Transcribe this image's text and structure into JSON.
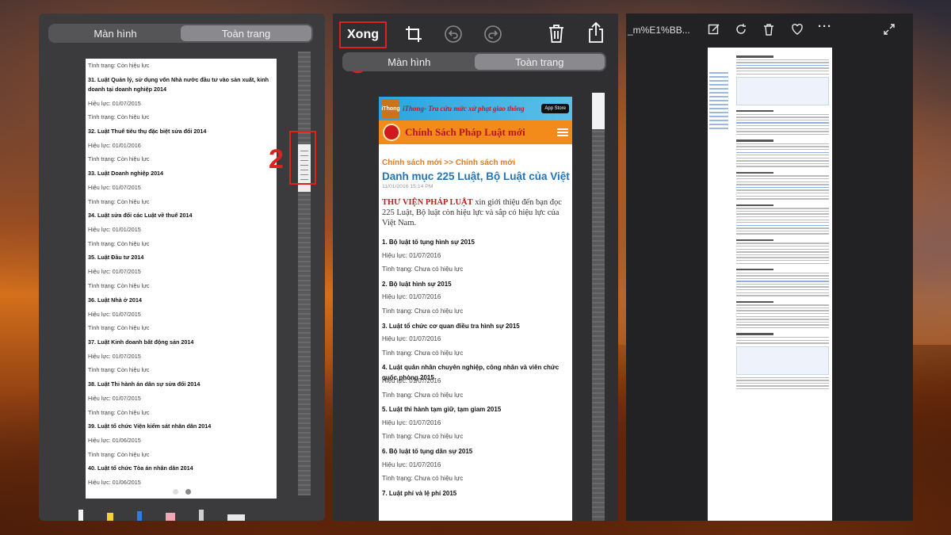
{
  "left_panel": {
    "segment": {
      "options": [
        "Màn hình",
        "Toàn trang"
      ],
      "selected": "Toàn trang"
    },
    "doc_rows": [
      {
        "text": "Tình trạng: Còn hiệu lực",
        "bold": false
      },
      {
        "text": "31. Luật Quản lý, sử dụng vốn Nhà nước đầu tư vào sản xuất, kinh doanh tại doanh nghiệp 2014",
        "bold": true
      },
      {
        "text": "Hiệu lực: 01/07/2015",
        "bold": false
      },
      {
        "text": "Tình trạng: Còn hiệu lực",
        "bold": false
      },
      {
        "text": "32. Luật Thuế tiêu thụ đặc biệt sửa đổi 2014",
        "bold": true
      },
      {
        "text": "Hiệu lực: 01/01/2016",
        "bold": false
      },
      {
        "text": "Tình trạng: Còn hiệu lực",
        "bold": false
      },
      {
        "text": "33. Luật Doanh nghiệp 2014",
        "bold": true
      },
      {
        "text": "Hiệu lực: 01/07/2015",
        "bold": false
      },
      {
        "text": "Tình trạng: Còn hiệu lực",
        "bold": false
      },
      {
        "text": "34. Luật sửa đổi các Luật về thuế 2014",
        "bold": true
      },
      {
        "text": "Hiệu lực: 01/01/2015",
        "bold": false
      },
      {
        "text": "Tình trạng: Còn hiệu lực",
        "bold": false
      },
      {
        "text": "35. Luật Đầu tư 2014",
        "bold": true
      },
      {
        "text": "Hiệu lực: 01/07/2015",
        "bold": false
      },
      {
        "text": "Tình trạng: Còn hiệu lực",
        "bold": false
      },
      {
        "text": "36. Luật Nhà ở 2014",
        "bold": true
      },
      {
        "text": "Hiệu lực: 01/07/2015",
        "bold": false
      },
      {
        "text": "Tình trạng: Còn hiệu lực",
        "bold": false
      },
      {
        "text": "37. Luật Kinh doanh bất động sản 2014",
        "bold": true
      },
      {
        "text": "Hiệu lực: 01/07/2015",
        "bold": false
      },
      {
        "text": "Tình trạng: Còn hiệu lực",
        "bold": false
      },
      {
        "text": "38. Luật Thi hành án dân sự sửa đổi 2014",
        "bold": true
      },
      {
        "text": "Hiệu lực: 01/07/2015",
        "bold": false
      },
      {
        "text": "Tình trạng: Còn hiệu lực",
        "bold": false
      },
      {
        "text": "39. Luật tổ chức Viện kiểm sát nhân dân 2014",
        "bold": true
      },
      {
        "text": "Hiệu lực: 01/06/2015",
        "bold": false
      },
      {
        "text": "Tình trạng: Còn hiệu lực",
        "bold": false
      },
      {
        "text": "40. Luật tổ chức Tòa án nhân dân 2014",
        "bold": true
      },
      {
        "text": "Hiệu lực: 01/06/2015",
        "bold": false
      }
    ],
    "step_label": "2"
  },
  "middle_panel": {
    "done_label": "Xong",
    "step_label": "3",
    "icons": [
      "crop-icon",
      "undo-icon",
      "redo-icon",
      "trash-icon",
      "share-icon"
    ],
    "segment": {
      "options": [
        "Màn hình",
        "Toàn trang"
      ],
      "selected": "Toàn trang"
    },
    "banner_top_text": "iThong- Tra cứu mức xử phạt giao thông",
    "banner_logo_text": "iThong",
    "app_store_label": "App Store",
    "banner_site_text": "Chính Sách Pháp Luật mới",
    "breadcrumb": "Chính sách mới >> Chính sách mới",
    "title": "Danh mục 225 Luật, Bộ Luật của Việt Nam",
    "date": "11/01/2016 15:14 PM",
    "intro_highlight": "THƯ VIỆN PHÁP LUẬT",
    "intro_rest": " xin giới thiệu đến bạn đọc 225 Luật, Bộ luật còn hiệu lực và sắp có hiệu lực của Việt Nam.",
    "doc_rows": [
      {
        "text": "1. Bộ luật tố tụng hình sự 2015",
        "bold": true
      },
      {
        "text": "Hiệu lực: 01/07/2016",
        "bold": false
      },
      {
        "text": "Tình trạng: Chưa có hiệu lực",
        "bold": false
      },
      {
        "text": "2. Bộ luật hình sự 2015",
        "bold": true
      },
      {
        "text": "Hiệu lực: 01/07/2016",
        "bold": false
      },
      {
        "text": "Tình trạng: Chưa có hiệu lực",
        "bold": false
      },
      {
        "text": "3. Luật tổ chức cơ quan điều tra hình sự 2015",
        "bold": true
      },
      {
        "text": "Hiệu lực: 01/07/2016",
        "bold": false
      },
      {
        "text": "Tình trạng: Chưa có hiệu lực",
        "bold": false
      },
      {
        "text": "4. Luật quân nhân chuyên nghiệp, công nhân và viên chức quốc phòng 2015",
        "bold": true
      },
      {
        "text": "Hiệu lực: 01/07/2016",
        "bold": false
      },
      {
        "text": "Tình trạng: Chưa có hiệu lực",
        "bold": false
      },
      {
        "text": "5. Luật thi hành tạm giữ, tạm giam 2015",
        "bold": true
      },
      {
        "text": "Hiệu lực: 01/07/2016",
        "bold": false
      },
      {
        "text": "Tình trạng: Chưa có hiệu lực",
        "bold": false
      },
      {
        "text": "6. Bộ luật tố tụng dân sự 2015",
        "bold": true
      },
      {
        "text": "Hiệu lực: 01/07/2016",
        "bold": false
      },
      {
        "text": "Tình trạng: Chưa có hiệu lực",
        "bold": false
      },
      {
        "text": "7. Luật phí và lệ phí 2015",
        "bold": true
      }
    ]
  },
  "right_panel": {
    "file_name": "_m%E1%BB...",
    "icons": [
      "markup-icon",
      "rotate-icon",
      "trash-icon",
      "heart-icon",
      "more-icon",
      "expand-icon"
    ]
  },
  "colors": {
    "annotation_red": "#e0201a",
    "breadcrumb_orange": "#e57a1b",
    "title_blue": "#2275b9"
  }
}
